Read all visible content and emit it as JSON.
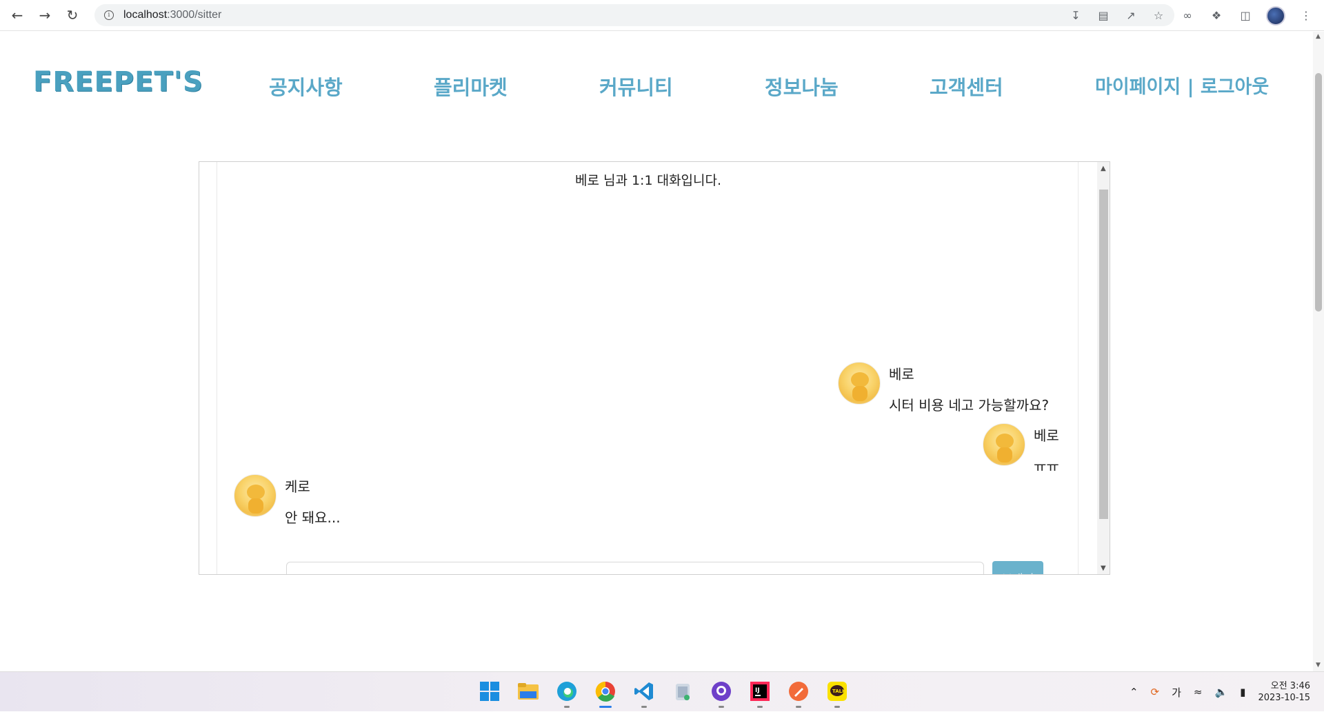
{
  "browser": {
    "url_host": "localhost",
    "url_path": ":3000/sitter",
    "back_icon": "arrow-left-icon",
    "forward_icon": "arrow-right-icon",
    "reload_icon": "reload-icon"
  },
  "site": {
    "logo": "FREEPET'S",
    "menu": [
      "공지사항",
      "플리마켓",
      "커뮤니티",
      "정보나눔",
      "고객센터"
    ],
    "account": "마이페이지 | 로그아웃"
  },
  "chat": {
    "title": "베로 님과 1:1 대화입니다.",
    "messages": [
      {
        "name": "베로",
        "text": "시터 비용 네고 가능할까요?"
      },
      {
        "name": "베로",
        "text": "ㅠㅠ"
      },
      {
        "name": "케로",
        "text": "안 돼요..."
      }
    ],
    "input_placeholder": "",
    "send_label": "보내기"
  },
  "taskbar": {
    "apps": [
      "windows-start",
      "file-explorer",
      "edge",
      "chrome",
      "vscode",
      "recycle",
      "github",
      "intellij",
      "pen",
      "kakaotalk"
    ],
    "ime": "가",
    "time": "오전 3:46",
    "date": "2023-10-15"
  },
  "colors": {
    "brand": "#4aa0bf",
    "menu": "#5aa8c8",
    "send_button": "#6ab2cc"
  }
}
